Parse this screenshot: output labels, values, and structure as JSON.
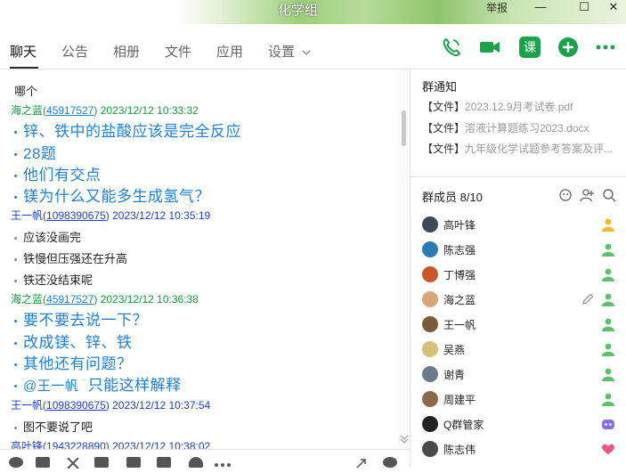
{
  "window": {
    "title": "化学组",
    "report_label": "举报",
    "minimize": "—",
    "maximize": "☐",
    "close": "✕"
  },
  "tabs": [
    {
      "label": "聊天"
    },
    {
      "label": "公告"
    },
    {
      "label": "相册"
    },
    {
      "label": "文件"
    },
    {
      "label": "应用"
    },
    {
      "label": "设置"
    }
  ],
  "toolbar": {
    "lesson_label": "课"
  },
  "messages": {
    "m0": {
      "line1": "哪个"
    },
    "m1": {
      "nick": "海之蓝",
      "qq": "45917527",
      "time": "2023/12/12 10:33:32",
      "lines": [
        "锌、铁中的盐酸应该是完全反应",
        "28题",
        "他们有交点",
        "镁为什么又能多生成氢气？"
      ]
    },
    "m2": {
      "nick": "王一帆",
      "qq": "1098390675",
      "time": "2023/12/12 10:35:19",
      "lines": [
        "应该没画完",
        "铁慢但压强还在升高",
        "铁还没结束呢"
      ]
    },
    "m3": {
      "nick": "海之蓝",
      "qq": "45917527",
      "time": "2023/12/12 10:36:38",
      "lines": [
        "要不要去说一下？",
        "改成镁、锌、铁",
        "其他还有问题？"
      ],
      "mention": "@王一帆",
      "mention_text": "只能这样解释"
    },
    "m4": {
      "nick": "王一帆",
      "qq": "1098390675",
      "time": "2023/12/12 10:37:54",
      "lines": [
        "图不要说了吧"
      ]
    },
    "m5": {
      "nick": "高叶锋",
      "qq": "1943228890",
      "time": "2023/12/12 10:38:02"
    }
  },
  "notice": {
    "title": "群通知",
    "files": [
      {
        "tag": "【文件】",
        "name": "2023.12.9月考试卷.pdf"
      },
      {
        "tag": "【文件】",
        "name": "溶液计算题练习2023.docx"
      },
      {
        "tag": "【文件】",
        "name": "九年级化学试题参考答案及评..."
      }
    ]
  },
  "members": {
    "title": "群成员 8/10",
    "list": [
      {
        "name": "高叶锋",
        "role": "owner"
      },
      {
        "name": "陈志强",
        "role": "admin"
      },
      {
        "name": "丁博强",
        "role": "admin"
      },
      {
        "name": "海之蓝",
        "role": "admin"
      },
      {
        "name": "王一帆",
        "role": "admin"
      },
      {
        "name": "吴燕",
        "role": "admin"
      },
      {
        "name": "谢青",
        "role": "admin"
      },
      {
        "name": "周建平",
        "role": "admin"
      },
      {
        "name": "Q群管家",
        "role": "bot"
      },
      {
        "name": "陈志伟",
        "role": "heart"
      }
    ]
  },
  "colors": {
    "owner": "#f2b829",
    "admin": "#5cc26a",
    "bot": "#8a6cf0",
    "heart": "#f0577a",
    "accent_green": "#1aa34a",
    "message_blue": "#2080d8"
  }
}
